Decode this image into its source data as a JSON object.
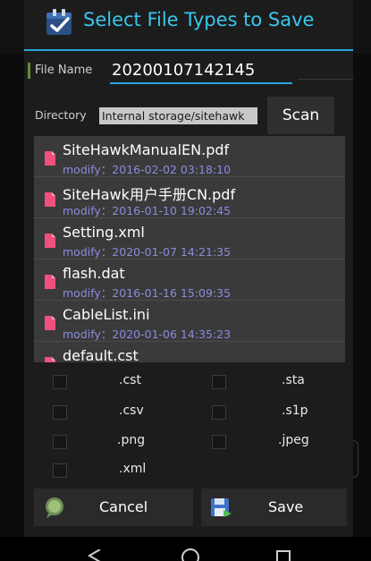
{
  "dialog": {
    "title": "Select File Types to Save"
  },
  "filename": {
    "label": "File Name",
    "value": "20200107142145"
  },
  "directory": {
    "label": "Directory",
    "value": "Internal storage/sitehawk",
    "scan_label": "Scan"
  },
  "files": [
    {
      "name": "SiteHawkManualEN.pdf",
      "modified": "modify：2016-02-02 03:18:10"
    },
    {
      "name": "SiteHawk用户手册CN.pdf",
      "modified": "modify：2016-01-10 19:02:45"
    },
    {
      "name": "Setting.xml",
      "modified": "modify：2020-01-07 14:21:35"
    },
    {
      "name": "flash.dat",
      "modified": "modify：2016-01-16 15:09:35"
    },
    {
      "name": "CableList.ini",
      "modified": "modify：2020-01-06 14:35:23"
    },
    {
      "name": "default.cst",
      "modified": ""
    }
  ],
  "file_types": [
    {
      "label": ".cst",
      "checked": false
    },
    {
      "label": ".sta",
      "checked": false
    },
    {
      "label": ".csv",
      "checked": false
    },
    {
      "label": ".s1p",
      "checked": false
    },
    {
      "label": ".png",
      "checked": false
    },
    {
      "label": ".jpeg",
      "checked": false
    },
    {
      "label": ".xml",
      "checked": false
    }
  ],
  "buttons": {
    "cancel_label": "Cancel",
    "save_label": "Save"
  },
  "icons": {
    "title": "checklist-clipboard-icon",
    "file": "pdf-file-icon",
    "cancel": "chat-bubble-icon",
    "save": "floppy-save-icon",
    "nav_back": "back-triangle-icon",
    "nav_home": "home-circle-icon",
    "nav_recents": "recents-square-icon"
  },
  "colors": {
    "accent": "#39c6ec",
    "modified_text": "#8a8cdd",
    "file_icon": "#f0507e"
  }
}
